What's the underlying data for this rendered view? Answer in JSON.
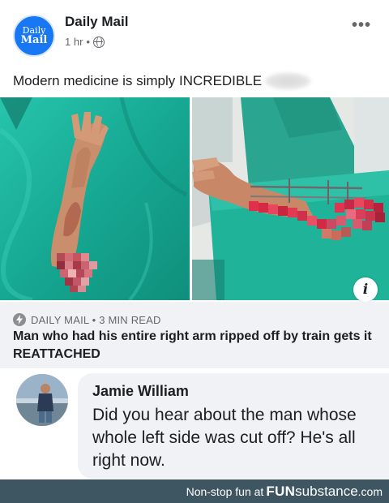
{
  "post": {
    "page_name": "Daily Mail",
    "avatar_line1": "Daily",
    "avatar_line2": "Mail",
    "time": "1 hr",
    "separator": "•",
    "caption": "Modern medicine is simply INCREDIBLE"
  },
  "link_preview": {
    "source": "DAILY MAIL • 3 MIN READ",
    "title": "Man who had his entire right arm ripped off by train gets it REATTACHED",
    "info_label": "i"
  },
  "comment": {
    "author": "Jamie William",
    "text": "Did you hear about the man whose whole left side was cut off? He's all right now."
  },
  "watermark": {
    "prefix": "Non-stop fun at",
    "brand_bold": "FUN",
    "brand_rest": "substance",
    "domain": ".com"
  },
  "colors": {
    "brand_blue": "#1877f2",
    "surgical_green": "#19b49a",
    "footer_bg": "#3e5562",
    "meta_gray": "#65676b"
  },
  "icons": [
    "globe-icon",
    "more-options-icon",
    "info-icon",
    "bolt-icon"
  ]
}
